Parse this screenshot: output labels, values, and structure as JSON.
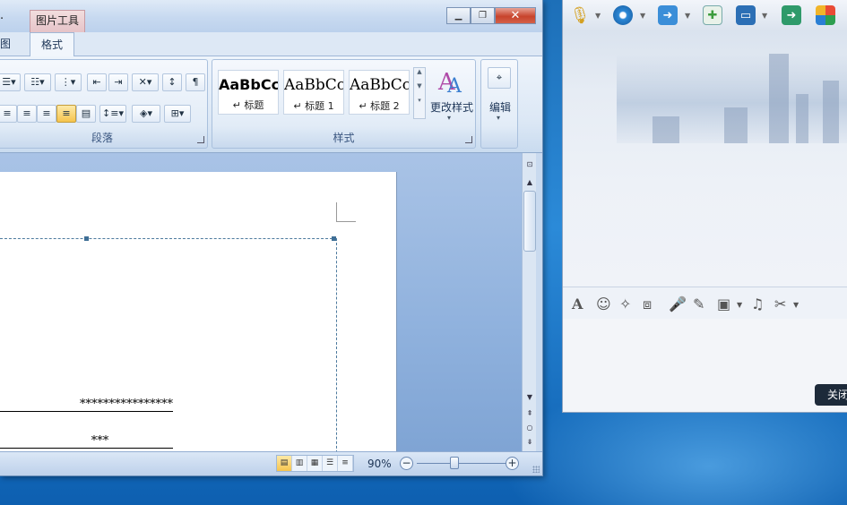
{
  "word": {
    "title_fragment": ".",
    "context_tab": "图片工具",
    "tabs": {
      "left_cut": "图",
      "format": "格式"
    },
    "help_glyph": "?",
    "groups": {
      "paragraph": "段落",
      "styles": "样式"
    },
    "styles": [
      {
        "sample": "AaBbCc",
        "name": "↵ 标题"
      },
      {
        "sample": "AaBbCc",
        "name": "↵ 标题 1"
      },
      {
        "sample": "AaBbCc",
        "name": "↵ 标题 2"
      }
    ],
    "change_styles_label": "更改样式",
    "edit_label": "编辑",
    "document": {
      "line1": "****************",
      "line2": "***"
    },
    "status": {
      "zoom": "90%"
    }
  },
  "qq": {
    "close_label": "关闭"
  },
  "colors": {
    "title_gradient": "#c7d9f0",
    "close_red": "#c7432c",
    "active_highlight": "#f6c44d"
  }
}
